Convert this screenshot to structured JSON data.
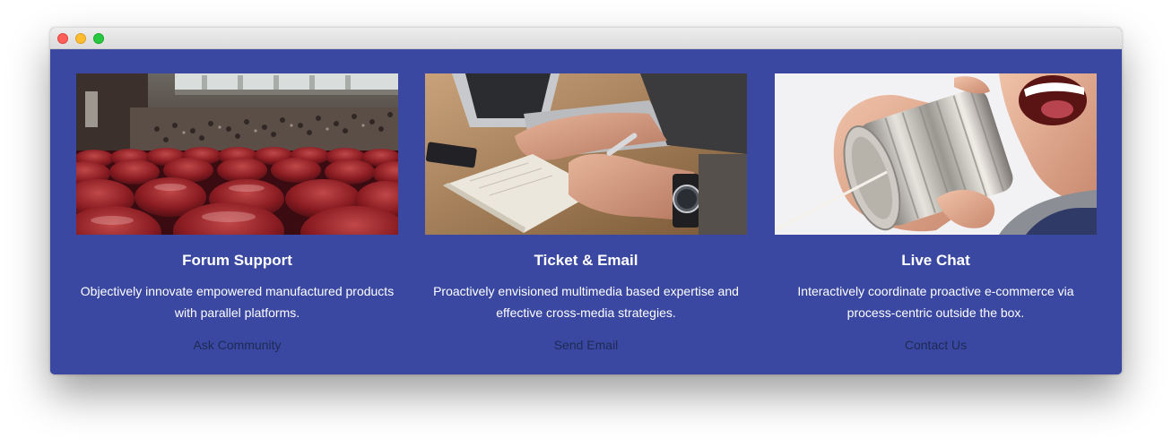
{
  "window": {
    "controls": [
      "close",
      "minimize",
      "maximize"
    ]
  },
  "colors": {
    "section_background": "#3a48a1",
    "title_text": "#ffffff",
    "link_text": "#1e2a55"
  },
  "cards": [
    {
      "image": "auditorium-red-seats-photo",
      "title": "Forum Support",
      "text": "Objectively innovate empowered manufactured products with parallel platforms.",
      "link": "Ask Community"
    },
    {
      "image": "hands-writing-notebook-photo",
      "title": "Ticket & Email",
      "text": "Proactively envisioned multimedia based expertise and effective cross-media strategies.",
      "link": "Send Email"
    },
    {
      "image": "tin-can-phone-photo",
      "title": "Live Chat",
      "text": "Interactively coordinate proactive e-commerce via process-centric outside the box.",
      "link": "Contact Us"
    }
  ]
}
